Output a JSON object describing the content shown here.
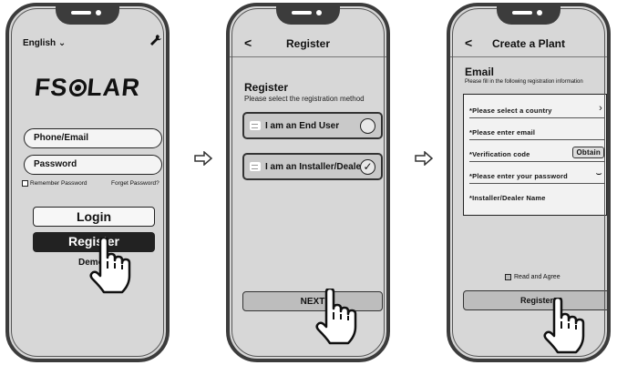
{
  "login_screen": {
    "language": "English",
    "language_chevron": "chevron-down-icon",
    "settings_icon": "wrench-icon",
    "logo_left": "F",
    "logo_mid": "S",
    "logo_right": "LAR",
    "phone_email_placeholder": "Phone/Email",
    "password_placeholder": "Password",
    "remember_password": "Remember Password",
    "forget_password": "Forget Password?",
    "login_label": "Login",
    "register_label": "Register",
    "demo_label": "Demo"
  },
  "method_screen": {
    "title": "Register",
    "heading": "Register",
    "subtitle": "Please select the registration method",
    "options": [
      {
        "label": "I am an End User",
        "selected": false
      },
      {
        "label": "I am an Installer/Dealer",
        "selected": true
      }
    ],
    "next_label": "NEXT"
  },
  "plant_screen": {
    "title": "Create a Plant",
    "heading": "Email",
    "subtitle": "Please fill in the following registration information",
    "fields": [
      {
        "label": "*Please select a country"
      },
      {
        "label": "*Please enter email"
      },
      {
        "label": "*Verification code",
        "button": "Obtain"
      },
      {
        "label": "*Please enter your password"
      },
      {
        "label": "*Installer/Dealer Name"
      }
    ],
    "read_agree": "Read and Agree",
    "register_label": "Register"
  },
  "colors": {
    "phone_frame": "#3c3c3c",
    "screen_bg": "#d7d7d7",
    "dark_button": "#222222"
  }
}
